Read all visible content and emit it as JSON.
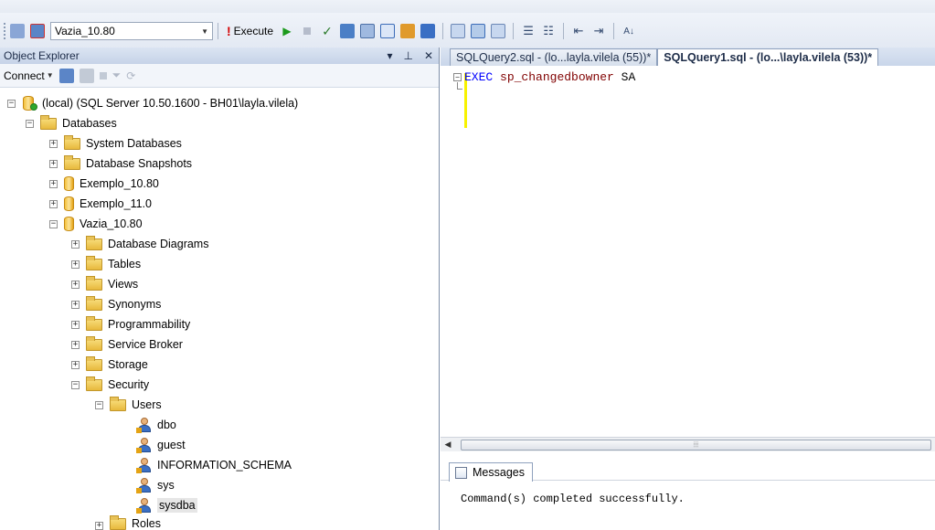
{
  "toolbar": {
    "database": "Vazia_10.80",
    "execute_label": "Execute"
  },
  "object_explorer": {
    "title": "Object Explorer",
    "pin": "− ɨ",
    "close": "✕",
    "connect_label": "Connect",
    "tree": [
      {
        "label": "(local) (SQL Server 10.50.1600 - BH01\\layla.vilela)"
      },
      {
        "label": "Databases"
      },
      {
        "label": "System Databases"
      },
      {
        "label": "Database Snapshots"
      },
      {
        "label": "Exemplo_10.80"
      },
      {
        "label": "Exemplo_11.0"
      },
      {
        "label": "Vazia_10.80"
      },
      {
        "label": "Database Diagrams"
      },
      {
        "label": "Tables"
      },
      {
        "label": "Views"
      },
      {
        "label": "Synonyms"
      },
      {
        "label": "Programmability"
      },
      {
        "label": "Service Broker"
      },
      {
        "label": "Storage"
      },
      {
        "label": "Security"
      },
      {
        "label": "Users"
      },
      {
        "label": "dbo"
      },
      {
        "label": "guest"
      },
      {
        "label": "INFORMATION_SCHEMA"
      },
      {
        "label": "sys"
      },
      {
        "label": "sysdba"
      },
      {
        "label": "Roles"
      }
    ]
  },
  "editor": {
    "tabs": [
      {
        "label": "SQLQuery2.sql - (lo...layla.vilela (55))*"
      },
      {
        "label": "SQLQuery1.sql - (lo...\\layla.vilela (53))*"
      }
    ],
    "code_keyword": "EXEC",
    "code_proc": "sp_changedbowner",
    "code_arg": "SA"
  },
  "results": {
    "tab_label": "Messages",
    "message": "Command(s) completed successfully."
  }
}
